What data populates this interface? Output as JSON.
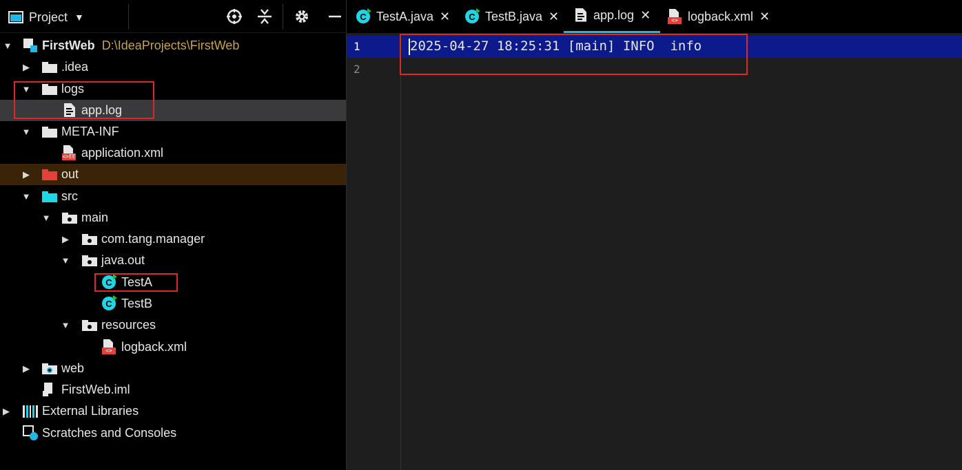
{
  "project_panel": {
    "title": "Project",
    "tree": [
      {
        "label": "FirstWeb",
        "path": "D:\\IdeaProjects\\FirstWeb"
      },
      {
        "label": ".idea"
      },
      {
        "label": "logs"
      },
      {
        "label": "app.log"
      },
      {
        "label": "META-INF"
      },
      {
        "label": "application.xml"
      },
      {
        "label": "out"
      },
      {
        "label": "src"
      },
      {
        "label": "main"
      },
      {
        "label": "com.tang.manager"
      },
      {
        "label": "java.out"
      },
      {
        "label": "TestA"
      },
      {
        "label": "TestB"
      },
      {
        "label": "resources"
      },
      {
        "label": "logback.xml"
      },
      {
        "label": "web"
      },
      {
        "label": "FirstWeb.iml"
      },
      {
        "label": "External Libraries"
      },
      {
        "label": "Scratches and Consoles"
      }
    ]
  },
  "editor": {
    "tabs": [
      {
        "label": "TestA.java",
        "icon": "java-class-icon"
      },
      {
        "label": "TestB.java",
        "icon": "java-class-icon"
      },
      {
        "label": "app.log",
        "icon": "text-file-icon",
        "active": true
      },
      {
        "label": "logback.xml",
        "icon": "xml-file-icon"
      }
    ],
    "line_numbers": [
      "1",
      "2"
    ],
    "lines": [
      "2025-04-27 18:25:31 [main] INFO  info",
      ""
    ]
  },
  "colors": {
    "accent": "#1fb7e6",
    "selection_row": "#3a3a3c",
    "excluded_row": "#3b2308",
    "current_line": "#0c1a8c",
    "highlight_box": "#e0262a",
    "path_text": "#c9a24a"
  }
}
